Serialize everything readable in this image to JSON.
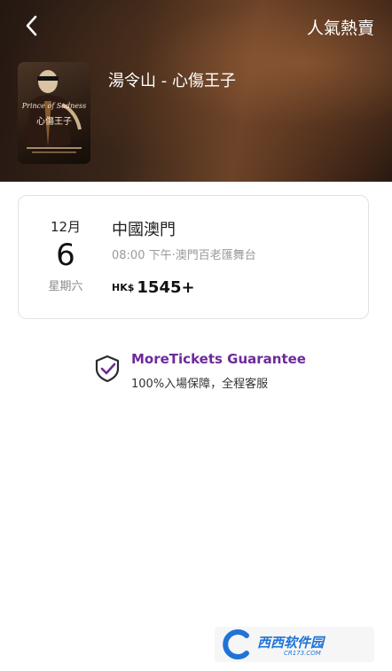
{
  "header": {
    "title": "人氣熱賣",
    "back_icon": "chevron-left-icon"
  },
  "show": {
    "name": "湯令山 - 心傷王子",
    "poster": {
      "title_en": "Prince of Sadness",
      "title_cn": "心傷王子"
    }
  },
  "session": {
    "month": "12月",
    "day": "6",
    "weekday": "星期六",
    "city": "中國澳門",
    "details": "08:00 下午·澳門百老匯舞台",
    "price_currency": "HK$",
    "price_value": "1545+"
  },
  "guarantee": {
    "icon": "shield-check-icon",
    "title": "MoreTickets Guarantee",
    "subtitle": "100%入場保障，全程客服",
    "accent_color": "#6d2a9a"
  },
  "watermark": {
    "text": "西西软件园",
    "sub": "CR173.COM"
  }
}
